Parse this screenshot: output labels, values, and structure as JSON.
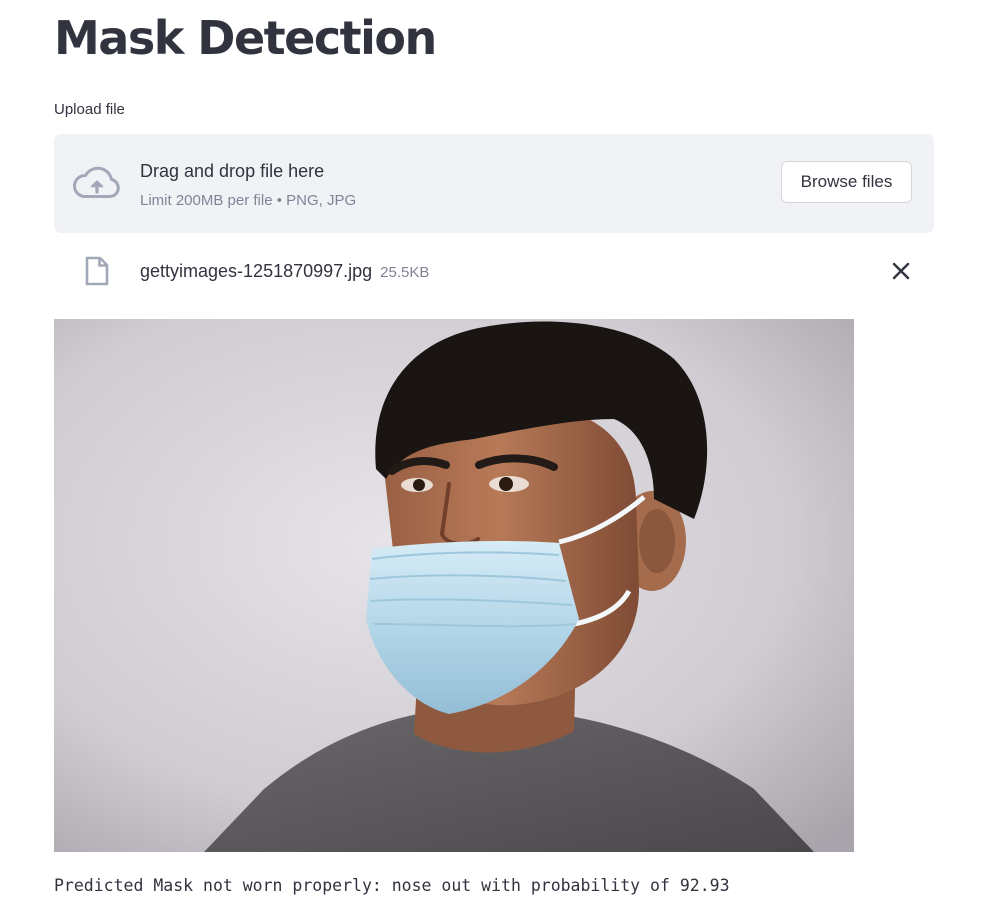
{
  "page": {
    "title": "Mask Detection"
  },
  "uploader": {
    "label": "Upload file",
    "dropzone_text": "Drag and drop file here",
    "limit_text": "Limit 200MB per file • PNG, JPG",
    "browse_label": "Browse files",
    "icon": "cloud-upload-icon"
  },
  "uploaded_file": {
    "name": "gettyimages-1251870997.jpg",
    "size": "25.5KB",
    "file_icon": "file-icon",
    "remove_icon": "close-icon"
  },
  "image": {
    "description": "photo-of-person-wearing-face-mask-below-nose"
  },
  "result": {
    "text": "Predicted Mask not worn properly: nose out with probability of 92.93"
  },
  "colors": {
    "text": "#31333f",
    "muted": "#808495",
    "dropzone_bg": "#f0f2f6",
    "icon": "#a3a8b8"
  }
}
